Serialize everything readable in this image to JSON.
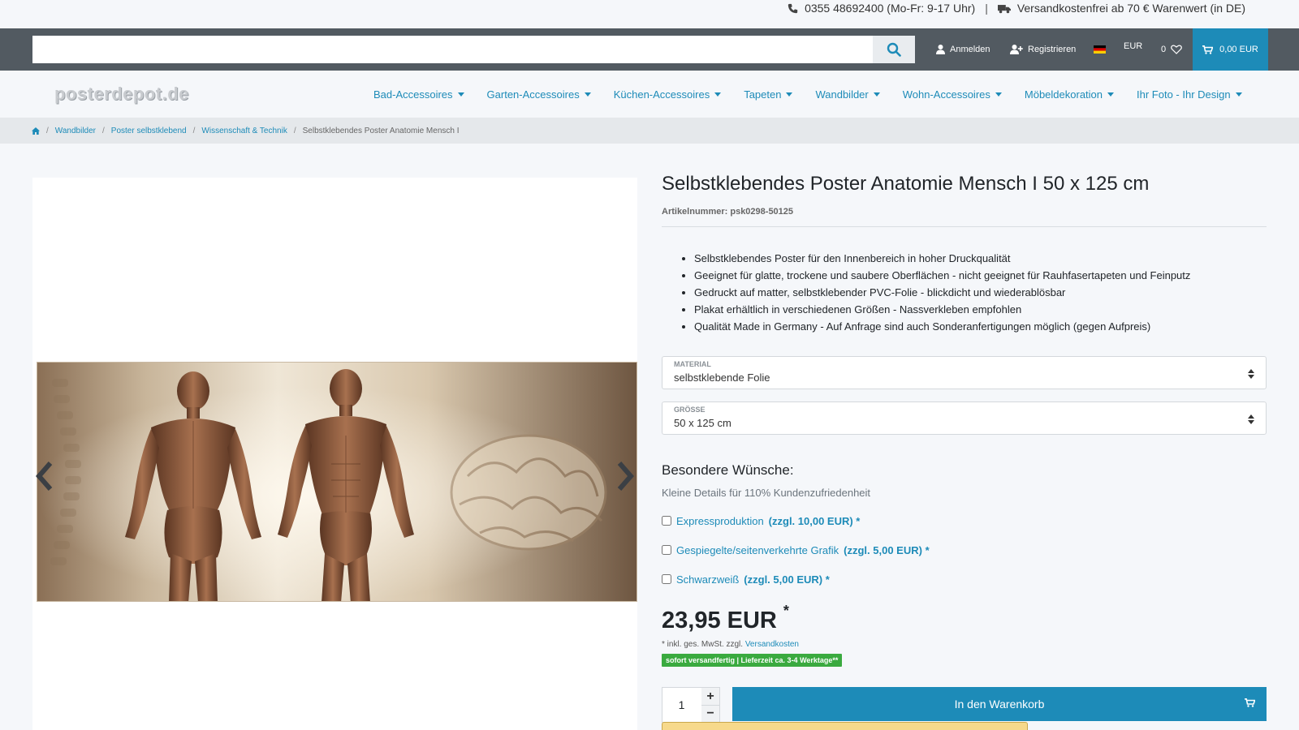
{
  "topbar": {
    "phone": "0355 48692400 (Mo-Fr: 9-17 Uhr)",
    "separator": "|",
    "shipping": "Versandkostenfrei ab 70 € Warenwert (in DE)"
  },
  "header": {
    "search_value": "",
    "login": "Anmelden",
    "register": "Registrieren",
    "currency": "EUR",
    "wishlist_count": "0",
    "cart_total": "0,00 EUR"
  },
  "logo": "posterdepot.de",
  "nav": [
    {
      "label": "Bad-Accessoires"
    },
    {
      "label": "Garten-Accessoires"
    },
    {
      "label": "Küchen-Accessoires"
    },
    {
      "label": "Tapeten"
    },
    {
      "label": "Wandbilder"
    },
    {
      "label": "Wohn-Accessoires"
    },
    {
      "label": "Möbeldekoration"
    },
    {
      "label": "Ihr Foto - Ihr Design"
    }
  ],
  "breadcrumb": {
    "items": [
      "Wandbilder",
      "Poster selbstklebend",
      "Wissenschaft & Technik"
    ],
    "separator": "/",
    "current": "Selbstklebendes Poster Anatomie Mensch I"
  },
  "product": {
    "title": "Selbstklebendes Poster Anatomie Mensch I 50 x 125 cm",
    "sku": "Artikelnummer: psk0298-50125",
    "features": [
      "Selbstklebendes Poster für den Innenbereich in hoher Druckqualität",
      "Geeignet für glatte, trockene und saubere Oberflächen - nicht geeignet für Rauhfasertapeten und Feinputz",
      "Gedruckt auf matter, selbstklebender PVC-Folie - blickdicht und wiederablösbar",
      "Plakat erhältlich in verschiedenen Größen - Nassverkleben empfohlen",
      "Qualität Made in Germany - Auf Anfrage sind auch Sonderanfertigungen möglich (gegen Aufpreis)"
    ],
    "material": {
      "label": "MATERIAL",
      "value": "selbstklebende Folie"
    },
    "size": {
      "label": "GRÖSSE",
      "value": "50 x 125 cm"
    },
    "wishes_title": "Besondere Wünsche:",
    "wishes_sub": "Kleine Details für 110% Kundenzufriedenheit",
    "options": [
      {
        "label": "Expressproduktion",
        "price": "(zzgl. 10,00 EUR) *"
      },
      {
        "label": "Gespiegelte/seitenverkehrte Grafik",
        "price": "(zzgl. 5,00 EUR) *"
      },
      {
        "label": "Schwarzweiß",
        "price": "(zzgl. 5,00 EUR) *"
      }
    ],
    "price": "23,95 EUR",
    "price_star": "*",
    "vat_text": "* inkl. ges. MwSt. zzgl.",
    "vat_link": "Versandkosten",
    "delivery_badge": "sofort versandfertig | Lieferzeit ca. 3-4 Werktage**",
    "quantity": "1",
    "qty_plus": "+",
    "qty_minus": "−",
    "add_to_cart": "In den Warenkorb"
  },
  "colors": {
    "primary": "#1d8bb8",
    "header_bg": "#525a61",
    "badge_green": "#3aaa3f"
  },
  "icons": [
    "phone-icon",
    "truck-icon",
    "search-icon",
    "user-icon",
    "user-plus-icon",
    "flag-de-icon",
    "heart-icon",
    "cart-icon",
    "home-icon",
    "chevron-left-icon",
    "chevron-right-icon"
  ]
}
